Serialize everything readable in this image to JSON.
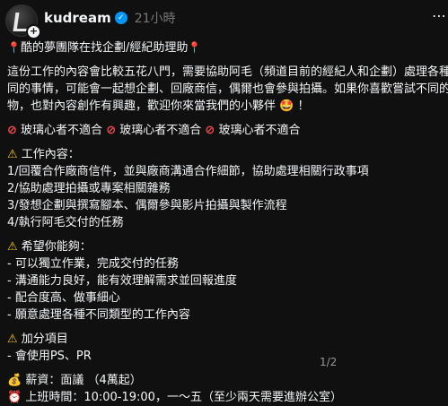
{
  "post": {
    "username": "kudream",
    "time": "21小時",
    "title": "酷的夢團隊在找企劃/經紀助理助",
    "intro_lines": [
      "這份工作的內容會比較五花八門，需要協助阿毛（頻道目前的經紀人和企劃）處理各種不",
      "同的事情，可能會一起想企劃、回廠商信，偶爾也會參與拍攝。如果你喜歡嘗試不同的事",
      "物，也對內容創作有興趣，歡迎你來當我們的小夥伴"
    ],
    "warning_items": [
      "玻璃心者不適合",
      "玻璃心者不適合",
      "玻璃心者不適合"
    ],
    "duties": {
      "heading": "工作內容：",
      "items": [
        "1/回覆合作廠商信件，並與廠商溝通合作細節，協助處理相關行政事項",
        "2/協助處理拍攝或專案相關雜務",
        "3/發想企劃與撰寫腳本、偶爾參與影片拍攝與製作流程",
        "4/執行阿毛交付的任務"
      ]
    },
    "hopes": {
      "heading": "希望你能夠：",
      "items": [
        "- 可以獨立作業，完成交付的任務",
        "- 溝通能力良好，能有效理解需求並回報進度",
        "- 配合度高、做事細心",
        "- 願意處理各種不同類型的工作內容"
      ]
    },
    "bonus": {
      "heading": "加分項目",
      "items": [
        "- 會使用PS、PR"
      ]
    },
    "salary": "薪資：面議 （4萬起）",
    "hours": "上班時間：10:00-19:00，一～五（至少兩天需要進辦公室）",
    "page_indicator": "1/2"
  },
  "icons": {
    "pin": "round-pushpin-icon",
    "no_entry": "prohibited-icon",
    "warning": "warning-icon",
    "money_bag": "money-bag-icon",
    "clock": "clock-icon",
    "face": "star-struck-face-icon"
  },
  "colors": {
    "background": "#101010",
    "text": "#f3f5f7",
    "muted": "#777777",
    "verified": "#0095f6"
  }
}
